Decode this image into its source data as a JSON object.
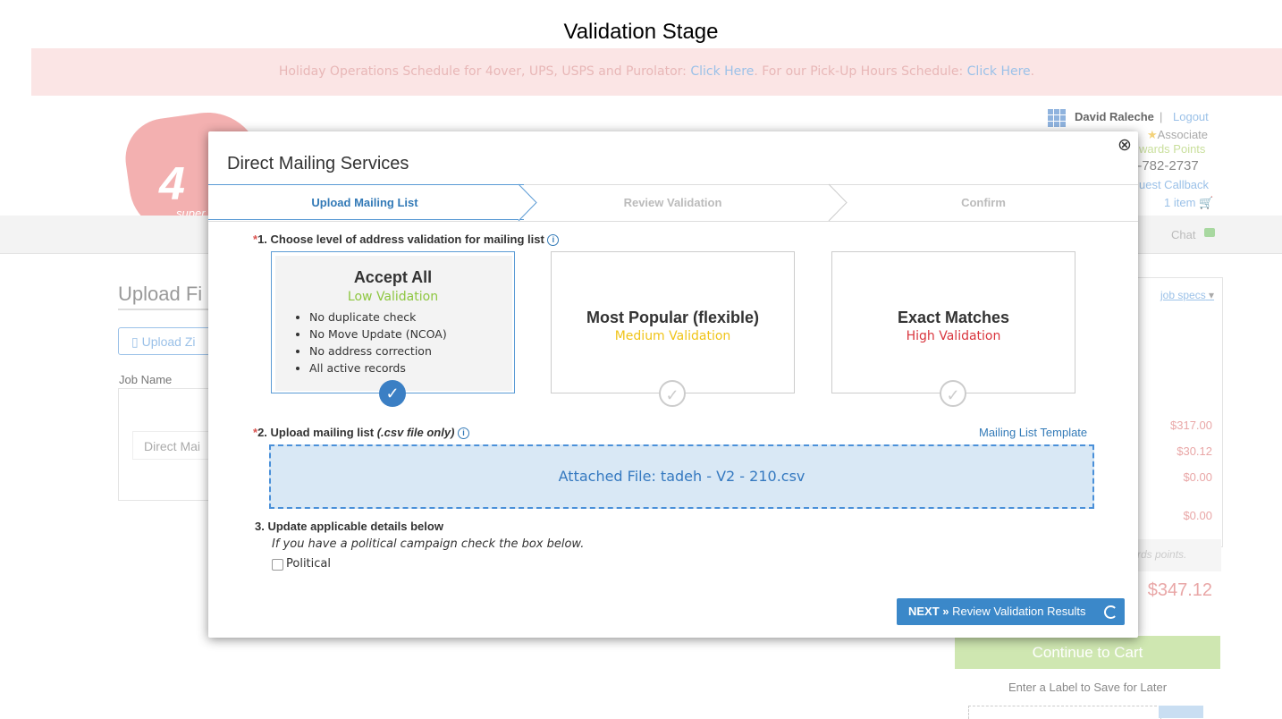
{
  "caption": "Validation Stage",
  "banner": {
    "text1": "Holiday Operations Schedule for 4over, UPS, USPS and Purolator: ",
    "link1": "Click Here",
    "text2": ".   For our Pick-Up Hours Schedule: ",
    "link2": "Click Here",
    "text3": "."
  },
  "logo": {
    "text": "4",
    "sub": "super"
  },
  "header": {
    "user_name": "David Raleche",
    "separator": "|",
    "logout": "Logout",
    "associate": "Associate",
    "rewards": "wards Points",
    "phone": "7-782-2737",
    "callback": "uest Callback",
    "cart": "1 item"
  },
  "nav": {
    "chat": "Chat"
  },
  "page": {
    "title": "Upload Fi",
    "upload_zip": "Upload Zi",
    "job_name_label": "Job Name",
    "job_name_value": "Direct Mai"
  },
  "sidebar": {
    "job_specs": "job specs",
    "prices": [
      "$317.00",
      "$30.12",
      "$0.00",
      "$0.00"
    ],
    "points_note": "rds points.",
    "total": "$347.12",
    "continue_cart": "Continue to Cart",
    "save_label": "Enter a Label to Save for Later"
  },
  "modal": {
    "title": "Direct Mailing Services",
    "close": "⊗",
    "steps": [
      "Upload Mailing List",
      "Review Validation",
      "Confirm"
    ],
    "q1_prefix": "*",
    "q1": "1. Choose level of address validation for mailing list",
    "info_glyph": "i",
    "cards": [
      {
        "title": "Accept All",
        "subtitle": "Low Validation",
        "subtitle_color": "#8dc63f",
        "bullets": [
          "No duplicate check",
          "No Move Update (NCOA)",
          "No address correction",
          "All active records"
        ],
        "selected": true
      },
      {
        "title": "Most Popular (flexible)",
        "subtitle": "Medium Validation",
        "subtitle_color": "#f0c419",
        "selected": false
      },
      {
        "title": "Exact Matches",
        "subtitle": "High Validation",
        "subtitle_color": "#d9363e",
        "selected": false
      }
    ],
    "check_glyph": "✓",
    "q2_prefix": "*",
    "q2_main": "2. Upload mailing list ",
    "q2_em": "(.csv file only)",
    "template_link": "Mailing List Template",
    "attached_file": "Attached File: tadeh - V2 - 210.csv",
    "q3": "3. Update applicable details below",
    "political_note": "If you have a political campaign check the box below.",
    "political_label": "Political",
    "next_bold": "NEXT »",
    "next_text": " Review Validation Results"
  },
  "colors": {
    "accent": "#3b88c9",
    "required": "#d9534f",
    "selected_border": "#5b9bd5",
    "dropzone_bg": "#d9e8f5"
  }
}
